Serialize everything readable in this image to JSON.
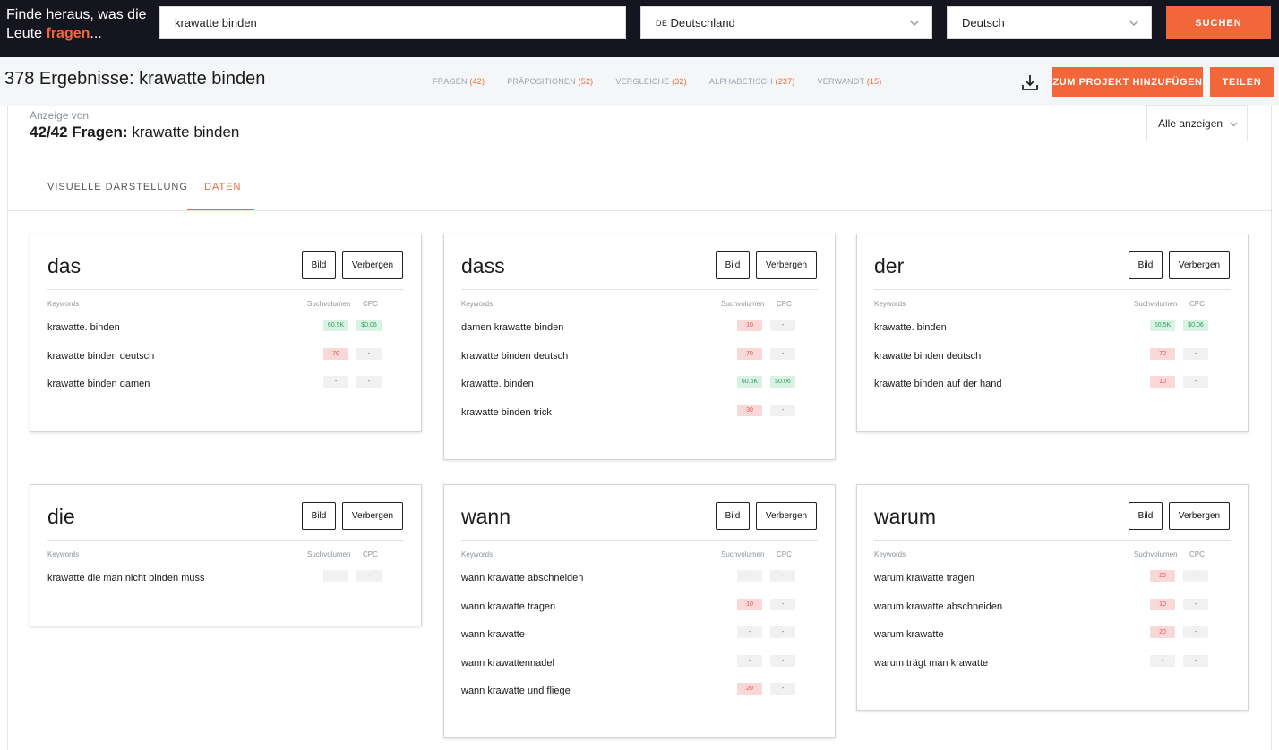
{
  "topbar": {
    "tagline_line1": "Finde heraus, was die",
    "tagline_line2_prefix": "Leute",
    "tagline_highlight": "fragen",
    "tagline_suffix": "...",
    "search_value": "krawatte binden",
    "country_flag": "DE",
    "country_value": "Deutschland",
    "language_value": "Deutsch",
    "search_button": "SUCHEN"
  },
  "results": {
    "count_text": "378 Ergebnisse:",
    "query": "krawatte binden",
    "filters": [
      {
        "label": "FRAGEN",
        "count": "(42)"
      },
      {
        "label": "PRÄPOSITIONEN",
        "count": "(52)"
      },
      {
        "label": "VERGLEICHE",
        "count": "(32)"
      },
      {
        "label": "ALPHABETISCH",
        "count": "(237)"
      },
      {
        "label": "VERWANDT",
        "count": "(15)"
      }
    ],
    "project_button": "ZUM PROJEKT HINZUFÜGEN",
    "share_button": "TEILEN"
  },
  "content": {
    "display_of": "Anzeige von",
    "heading_bold": "42/42 Fragen:",
    "heading_query": "krawatte binden",
    "show_all": "Alle anzeigen",
    "tab_visual": "VISUELLE DARSTELLUNG",
    "tab_data": "DATEN"
  },
  "card_labels": {
    "bild": "Bild",
    "verbergen": "Verbergen",
    "col_keywords": "Keywords",
    "col_volume": "Suchvolumen",
    "col_cpc": "CPC"
  },
  "cards": [
    {
      "title": "das",
      "rows": [
        {
          "keyword": "krawatte. binden",
          "volume": "60.5K",
          "volume_color": "green",
          "cpc": "$0.06",
          "cpc_color": "green"
        },
        {
          "keyword": "krawatte binden deutsch",
          "volume": "70",
          "volume_color": "red",
          "cpc": "-",
          "cpc_color": "gray"
        },
        {
          "keyword": "krawatte binden damen",
          "volume": "-",
          "volume_color": "gray",
          "cpc": "-",
          "cpc_color": "gray"
        }
      ]
    },
    {
      "title": "dass",
      "rows": [
        {
          "keyword": "damen krawatte binden",
          "volume": "10",
          "volume_color": "red",
          "cpc": "-",
          "cpc_color": "gray"
        },
        {
          "keyword": "krawatte binden deutsch",
          "volume": "70",
          "volume_color": "red",
          "cpc": "-",
          "cpc_color": "gray"
        },
        {
          "keyword": "krawatte. binden",
          "volume": "60.5K",
          "volume_color": "green",
          "cpc": "$0.06",
          "cpc_color": "green"
        },
        {
          "keyword": "krawatte binden trick",
          "volume": "30",
          "volume_color": "red",
          "cpc": "-",
          "cpc_color": "gray"
        }
      ]
    },
    {
      "title": "der",
      "rows": [
        {
          "keyword": "krawatte. binden",
          "volume": "60.5K",
          "volume_color": "green",
          "cpc": "$0.06",
          "cpc_color": "green"
        },
        {
          "keyword": "krawatte binden deutsch",
          "volume": "70",
          "volume_color": "red",
          "cpc": "-",
          "cpc_color": "gray"
        },
        {
          "keyword": "krawatte binden auf der hand",
          "volume": "10",
          "volume_color": "red",
          "cpc": "-",
          "cpc_color": "gray"
        }
      ]
    },
    {
      "title": "die",
      "rows": [
        {
          "keyword": "krawatte die man nicht binden muss",
          "volume": "-",
          "volume_color": "gray",
          "cpc": "-",
          "cpc_color": "gray"
        }
      ]
    },
    {
      "title": "wann",
      "rows": [
        {
          "keyword": "wann krawatte abschneiden",
          "volume": "-",
          "volume_color": "gray",
          "cpc": "-",
          "cpc_color": "gray"
        },
        {
          "keyword": "wann krawatte tragen",
          "volume": "10",
          "volume_color": "red",
          "cpc": "-",
          "cpc_color": "gray"
        },
        {
          "keyword": "wann krawatte",
          "volume": "-",
          "volume_color": "gray",
          "cpc": "-",
          "cpc_color": "gray"
        },
        {
          "keyword": "wann krawattennadel",
          "volume": "-",
          "volume_color": "gray",
          "cpc": "-",
          "cpc_color": "gray"
        },
        {
          "keyword": "wann krawatte und fliege",
          "volume": "20",
          "volume_color": "red",
          "cpc": "-",
          "cpc_color": "gray"
        }
      ]
    },
    {
      "title": "warum",
      "rows": [
        {
          "keyword": "warum krawatte tragen",
          "volume": "20",
          "volume_color": "red",
          "cpc": "-",
          "cpc_color": "gray"
        },
        {
          "keyword": "warum krawatte abschneiden",
          "volume": "10",
          "volume_color": "red",
          "cpc": "-",
          "cpc_color": "gray"
        },
        {
          "keyword": "warum krawatte",
          "volume": "20",
          "volume_color": "red",
          "cpc": "-",
          "cpc_color": "gray"
        },
        {
          "keyword": "warum trägt man krawatte",
          "volume": "-",
          "volume_color": "gray",
          "cpc": "-",
          "cpc_color": "gray"
        }
      ]
    }
  ],
  "icons": {
    "download": "download-icon",
    "chevron": "chevron-down-icon"
  },
  "colors": {
    "accent": "#f2673a",
    "topbar_bg": "#151520",
    "badge_red_bg": "#fbd8d8",
    "badge_green_bg": "#d8f3e3"
  }
}
